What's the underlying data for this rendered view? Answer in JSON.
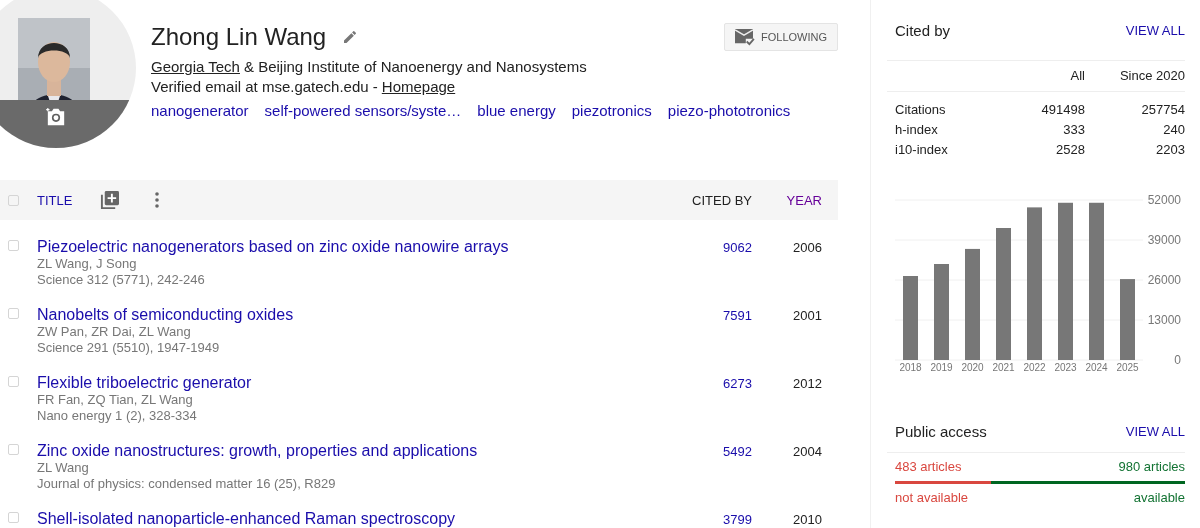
{
  "profile": {
    "name": "Zhong Lin Wang",
    "affiliation_link": "Georgia Tech",
    "affiliation_rest": "& Beijing Institute of Nanoenergy and Nanosystems",
    "email": "Verified email at mse.gatech.edu -",
    "homepage_link": "Homepage",
    "interests": [
      "nanogenerator",
      "self-powered sensors/syste…",
      "blue energy",
      "piezotronics",
      "piezo-phototronics"
    ],
    "follow_button": "FOLLOWING"
  },
  "table": {
    "select_all_checked": false,
    "columns": [
      {
        "label": "TITLE",
        "selected": false,
        "visited": false
      },
      {
        "label": "CITED BY",
        "selected": true,
        "visited": false
      },
      {
        "label": "YEAR",
        "selected": false,
        "visited": true
      }
    ],
    "rows": [
      {
        "checked": false,
        "title": "Piezoelectric nanogenerators based on zinc oxide nanowire arrays",
        "authors": "ZL Wang, J Song",
        "venue": "Science 312 (5771), 242-246",
        "cited_by": "9062",
        "year": "2006"
      },
      {
        "checked": false,
        "title": "Nanobelts of semiconducting oxides",
        "authors": "ZW Pan, ZR Dai, ZL Wang",
        "venue": "Science 291 (5510), 1947-1949",
        "cited_by": "7591",
        "year": "2001"
      },
      {
        "checked": false,
        "title": "Flexible triboelectric generator",
        "authors": "FR Fan, ZQ Tian, ZL Wang",
        "venue": "Nano energy 1 (2), 328-334",
        "cited_by": "6273",
        "year": "2012"
      },
      {
        "checked": false,
        "title": "Zinc oxide nanostructures: growth, properties and applications",
        "authors": "ZL Wang",
        "venue": "Journal of physics: condensed matter 16 (25), R829",
        "cited_by": "5492",
        "year": "2004"
      },
      {
        "checked": false,
        "title": "Shell-isolated nanoparticle-enhanced Raman spectroscopy",
        "cited_by": "3799",
        "year": "2010"
      }
    ]
  },
  "cited_by": {
    "title": "Cited by",
    "view_all": "VIEW ALL",
    "columns": [
      "All",
      "Since 2020"
    ],
    "rows": [
      {
        "label": "Citations",
        "all": "491498",
        "since": "257754"
      },
      {
        "label": "h-index",
        "all": "333",
        "since": "240"
      },
      {
        "label": "i10-index",
        "all": "2528",
        "since": "2203"
      }
    ],
    "chart_data": {
      "type": "bar",
      "categories": [
        "2018",
        "2019",
        "2020",
        "2021",
        "2022",
        "2023",
        "2024",
        "2025"
      ],
      "values": [
        27300,
        31200,
        36100,
        42900,
        49600,
        51100,
        51100,
        26300
      ],
      "ylim": [
        0,
        52000
      ],
      "yticks": [
        0,
        13000,
        26000,
        39000,
        52000
      ],
      "grid": true
    }
  },
  "public_access": {
    "title": "Public access",
    "view_all": "VIEW ALL",
    "not_available_count": "483 articles",
    "available_count": "980 articles",
    "level": 0.33,
    "not_available_label": "not available",
    "available_label": "available"
  }
}
